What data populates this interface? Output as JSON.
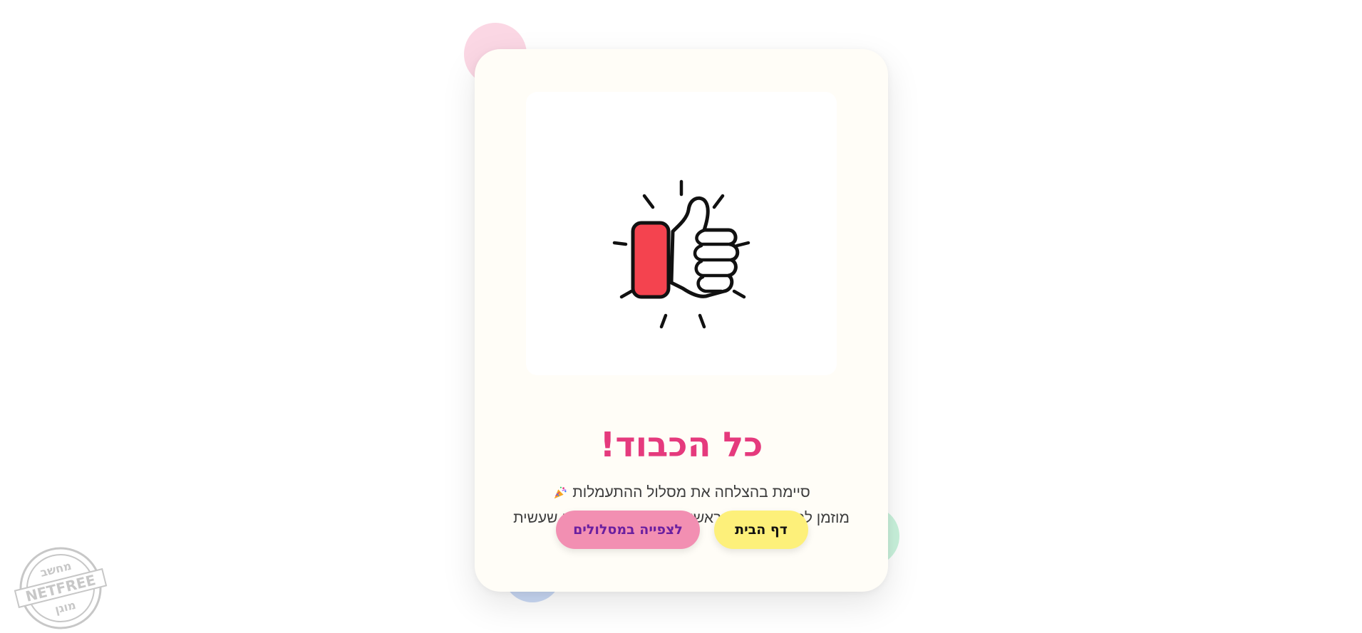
{
  "card": {
    "title": "כל הכבוד!",
    "message_line1": "סיימת בהצלחה את מסלול ההתעמלות",
    "message_line1_icon": "party-popper-icon",
    "message_line2": "מוזמן לחזור לעמוד הראשי או לצפות במסלולים שעשית",
    "illustration_icon": "thumbs-up-icon"
  },
  "buttons": {
    "home_label": "דף הבית",
    "view_paths_label": "לצפייה במסלולים"
  },
  "stamp": {
    "top_text": "מחשב",
    "middle_text": "NETFREE",
    "bottom_text": "מוגן"
  },
  "colors": {
    "title": "#e53a7d",
    "home_button": "#fdf07a",
    "paths_button": "#f28fb2",
    "paths_button_text": "#6a1fa0",
    "thumb_red": "#f4434f",
    "card_bg": "#fffdf7"
  }
}
